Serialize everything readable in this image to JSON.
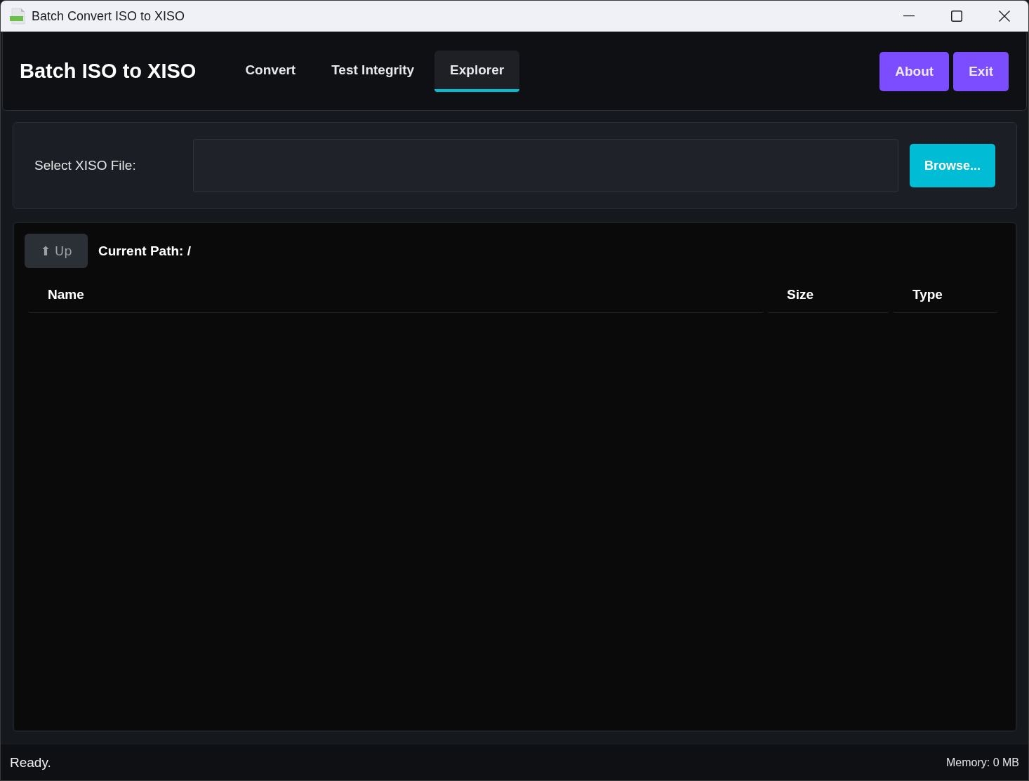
{
  "window": {
    "title": "Batch Convert ISO to XISO"
  },
  "header": {
    "brand": "Batch ISO to XISO",
    "tabs": [
      {
        "label": "Convert",
        "selected": false
      },
      {
        "label": "Test Integrity",
        "selected": false
      },
      {
        "label": "Explorer",
        "selected": true
      }
    ],
    "about_button": "About",
    "exit_button": "Exit"
  },
  "file_select": {
    "label": "Select XISO File:",
    "browse_button": "Browse..."
  },
  "explorer": {
    "up_button": "⬆ Up",
    "current_path": "Current Path: /",
    "columns": [
      "Name",
      "Size",
      "Type"
    ]
  },
  "status_bar": {
    "status": "Ready.",
    "memory": "Memory: 0 MB"
  }
}
